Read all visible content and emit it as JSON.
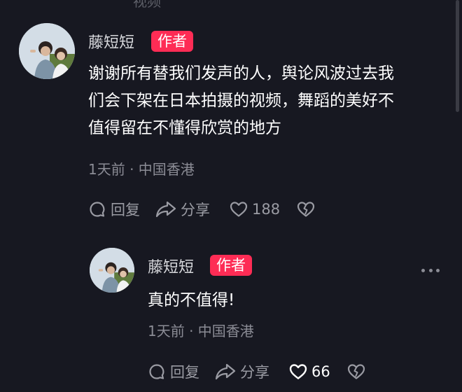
{
  "top_fragment": "视频",
  "comment": {
    "username": "藤短短",
    "badge": "作者",
    "text_lines": [
      "谢谢所有替我们发声的人，舆论风波过去我",
      "们会下架在日本拍摄的视频，舞蹈的美好不",
      "值得留在不懂得欣赏的地方"
    ],
    "meta": "1天前 · 中国香港",
    "reply_label": "回复",
    "share_label": "分享",
    "like_count": "188",
    "icons": [
      "reply-icon",
      "share-icon",
      "heart-icon",
      "dislike-icon"
    ]
  },
  "reply": {
    "username": "藤短短",
    "badge": "作者",
    "text": "真的不值得!",
    "meta": "1天前 · 中国香港",
    "reply_label": "回复",
    "share_label": "分享",
    "like_count": "66",
    "icons": [
      "more-icon",
      "reply-icon",
      "share-icon",
      "heart-icon",
      "dislike-icon"
    ]
  },
  "colors": {
    "background": "#171821",
    "badge": "#fe2c55",
    "secondary_text": "#8b8c95"
  }
}
